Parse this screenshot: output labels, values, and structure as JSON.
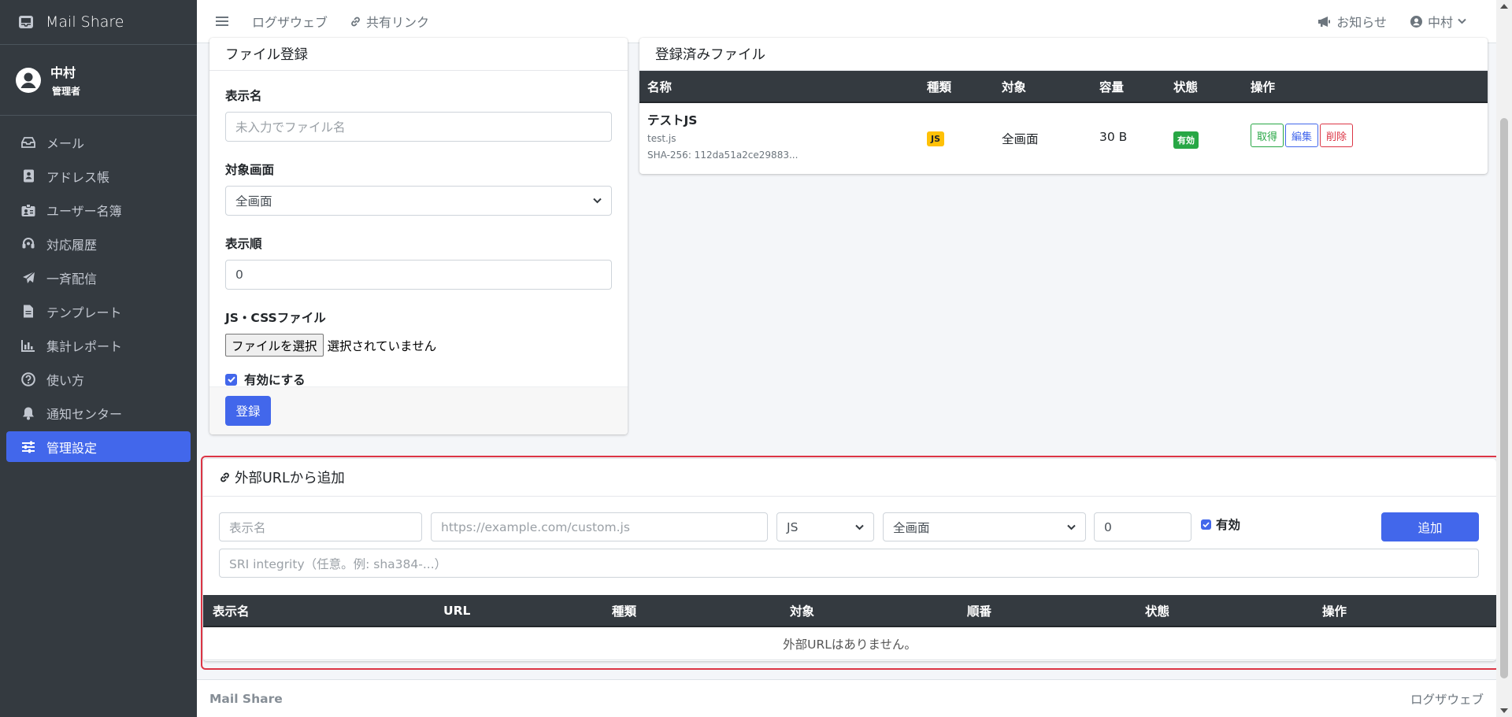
{
  "brand": {
    "name": "Mail Share"
  },
  "user": {
    "name": "中村",
    "role": "管理者"
  },
  "sidebar": {
    "items": [
      {
        "label": "メール",
        "icon": "inbox-icon"
      },
      {
        "label": "アドレス帳",
        "icon": "address-book-icon"
      },
      {
        "label": "ユーザー名簿",
        "icon": "id-badge-icon"
      },
      {
        "label": "対応履歴",
        "icon": "headset-icon"
      },
      {
        "label": "一斉配信",
        "icon": "paper-plane-icon"
      },
      {
        "label": "テンプレート",
        "icon": "file-icon"
      },
      {
        "label": "集計レポート",
        "icon": "bar-chart-icon"
      },
      {
        "label": "使い方",
        "icon": "question-circle-icon"
      },
      {
        "label": "通知センター",
        "icon": "bell-icon"
      },
      {
        "label": "管理設定",
        "icon": "sliders-icon",
        "active": true
      }
    ]
  },
  "topbar": {
    "logout": "ログザウェブ",
    "share_link": "共有リンク",
    "notice": "お知らせ",
    "user": "中村"
  },
  "file_form": {
    "title": "ファイル登録",
    "display_name_label": "表示名",
    "display_name_placeholder": "未入力でファイル名",
    "target_label": "対象画面",
    "target_value": "全画面",
    "order_label": "表示順",
    "order_value": "0",
    "file_label": "JS・CSSファイル",
    "file_button": "ファイルを選択",
    "file_status": "選択されていません",
    "enable_label": "有効にする",
    "submit": "登録"
  },
  "files": {
    "title": "登録済みファイル",
    "headers": [
      "名称",
      "種類",
      "対象",
      "容量",
      "状態",
      "操作"
    ],
    "rows": [
      {
        "name": "テストJS",
        "filename": "test.js",
        "hash": "SHA-256: 112da51a2ce29883...",
        "type": "JS",
        "target": "全画面",
        "size": "30 B",
        "status": "有効",
        "actions": {
          "get": "取得",
          "edit": "編集",
          "delete": "削除"
        }
      }
    ]
  },
  "external": {
    "title": "外部URLから追加",
    "name_placeholder": "表示名",
    "url_placeholder": "https://example.com/custom.js",
    "type_value": "JS",
    "target_value": "全画面",
    "order_value": "0",
    "enable_label": "有効",
    "add_button": "追加",
    "sri_placeholder": "SRI integrity（任意。例: sha384-...）",
    "headers": [
      "表示名",
      "URL",
      "種類",
      "対象",
      "順番",
      "状態",
      "操作"
    ],
    "empty": "外部URLはありません。"
  },
  "footer": {
    "brand": "Mail Share",
    "right": "ログザウェブ"
  },
  "colors": {
    "accent": "#4267eb",
    "sidebar": "#343a40",
    "highlight": "#dc3545"
  }
}
